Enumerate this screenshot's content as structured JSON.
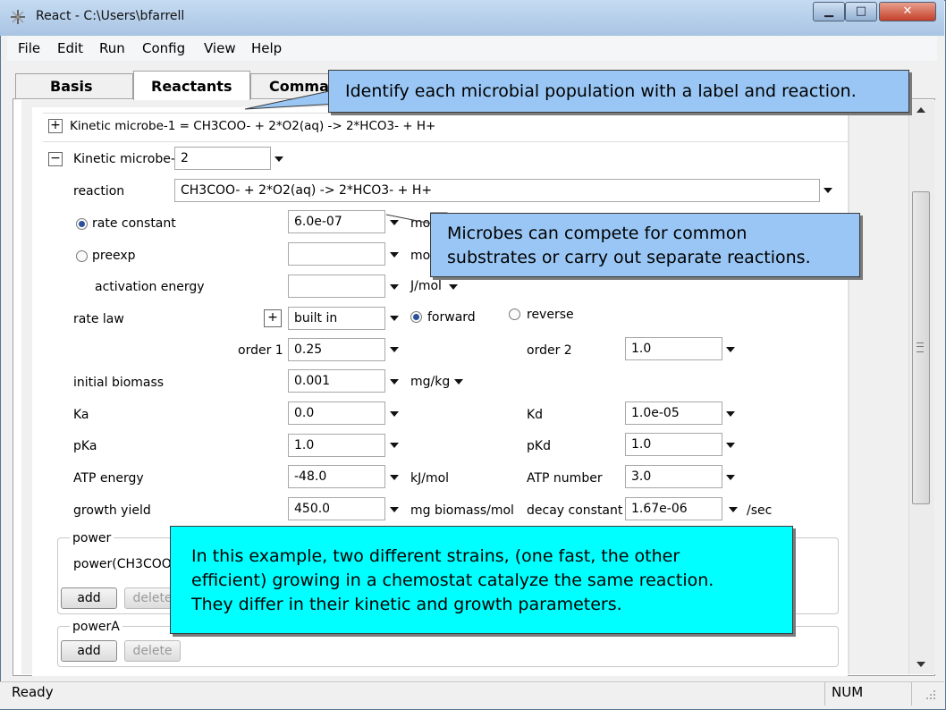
{
  "window": {
    "title": "React - C:\\Users\\bfarrell",
    "minimize": "▁",
    "maximize": "□",
    "close": "✕"
  },
  "menu": [
    {
      "label": "File"
    },
    {
      "label": "Edit"
    },
    {
      "label": "Run"
    },
    {
      "label": "Config"
    },
    {
      "label": "View"
    },
    {
      "label": "Help"
    }
  ],
  "tabs": {
    "basis": "Basis",
    "reactants": "Reactants",
    "command": "Comma"
  },
  "microbe1": {
    "summary": "Kinetic microbe-1 = CH3COO-  + 2*O2(aq)  -> 2*HCO3-  + H+"
  },
  "microbe2": {
    "header_label": "Kinetic microbe-",
    "number": "2",
    "reaction_label": "reaction",
    "reaction_value": "CH3COO-  + 2*O2(aq)  -> 2*HCO3-  + H+",
    "rate_constant_label": "rate constant",
    "rate_constant_value": "6.0e-07",
    "rate_constant_unit": "mo",
    "preexp_label": "preexp",
    "preexp_value": "",
    "preexp_unit": "mo",
    "activation_label": "activation energy",
    "activation_value": "",
    "activation_unit": "J/mol",
    "rate_law_label": "rate law",
    "rate_law_value": "built in",
    "forward_label": "forward",
    "reverse_label": "reverse",
    "order1_label": "order 1",
    "order1_value": "0.25",
    "order2_label": "order 2",
    "order2_value": "1.0",
    "biomass_label": "initial biomass",
    "biomass_value": "0.001",
    "biomass_unit": "mg/kg",
    "ka_label": "Ka",
    "ka_value": "0.0",
    "kd_label": "Kd",
    "kd_value": "1.0e-05",
    "pka_label": "pKa",
    "pka_value": "1.0",
    "pkd_label": "pKd",
    "pkd_value": "1.0",
    "atp_energy_label": "ATP energy",
    "atp_energy_value": "-48.0",
    "atp_energy_unit": "kJ/mol",
    "atp_number_label": "ATP number",
    "atp_number_value": "3.0",
    "growth_label": "growth yield",
    "growth_value": "450.0",
    "growth_unit": "mg biomass/mol",
    "decay_label": "decay constant",
    "decay_value": "1.67e-06",
    "decay_unit": "/sec"
  },
  "power_group": {
    "title": "power",
    "text": "power(CH3COO-",
    "add": "add",
    "delete": "delete"
  },
  "powerA_group": {
    "title": "powerA",
    "add": "add",
    "delete": "delete"
  },
  "callouts": {
    "top": "Identify each microbial population with a label and reaction.",
    "middle_line1": "Microbes can compete for common",
    "middle_line2": "substrates or carry out separate reactions.",
    "bottom_line1": "In this example, two different strains, (one fast, the other",
    "bottom_line2": "efficient) growing in a chemostat catalyze the same reaction.",
    "bottom_line3": "They differ in their kinetic and growth parameters."
  },
  "status": {
    "left": "Ready",
    "right": "NUM"
  }
}
